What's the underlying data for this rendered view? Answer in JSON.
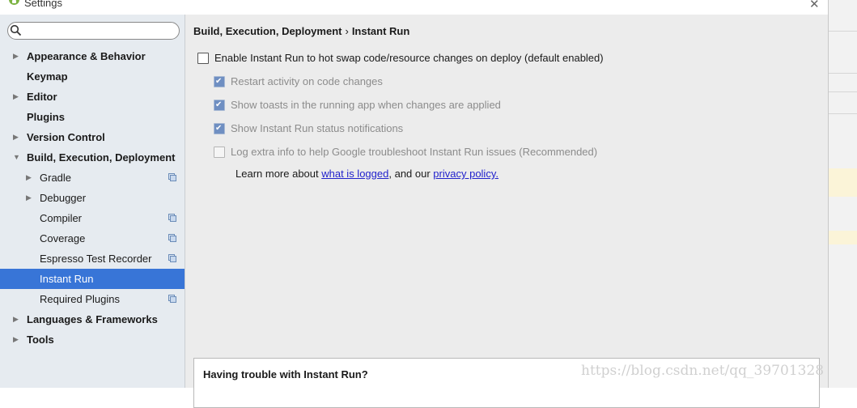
{
  "window": {
    "title": "Settings"
  },
  "search": {
    "placeholder": ""
  },
  "sidebar": {
    "items": [
      {
        "label": "Appearance & Behavior",
        "level": 0,
        "bold": true,
        "expandable": true,
        "expanded": false,
        "project_icon": false
      },
      {
        "label": "Keymap",
        "level": 0,
        "bold": true,
        "expandable": false,
        "project_icon": false
      },
      {
        "label": "Editor",
        "level": 0,
        "bold": true,
        "expandable": true,
        "expanded": false,
        "project_icon": false
      },
      {
        "label": "Plugins",
        "level": 0,
        "bold": true,
        "expandable": false,
        "project_icon": false
      },
      {
        "label": "Version Control",
        "level": 0,
        "bold": true,
        "expandable": true,
        "expanded": false,
        "project_icon": false
      },
      {
        "label": "Build, Execution, Deployment",
        "level": 0,
        "bold": true,
        "expandable": true,
        "expanded": true,
        "project_icon": false
      },
      {
        "label": "Gradle",
        "level": 1,
        "bold": false,
        "expandable": true,
        "expanded": false,
        "project_icon": true
      },
      {
        "label": "Debugger",
        "level": 1,
        "bold": false,
        "expandable": true,
        "expanded": false,
        "project_icon": false
      },
      {
        "label": "Compiler",
        "level": 1,
        "bold": false,
        "expandable": false,
        "project_icon": true
      },
      {
        "label": "Coverage",
        "level": 1,
        "bold": false,
        "expandable": false,
        "project_icon": true
      },
      {
        "label": "Espresso Test Recorder",
        "level": 1,
        "bold": false,
        "expandable": false,
        "project_icon": true
      },
      {
        "label": "Instant Run",
        "level": 1,
        "bold": false,
        "expandable": false,
        "project_icon": false,
        "selected": true
      },
      {
        "label": "Required Plugins",
        "level": 1,
        "bold": false,
        "expandable": false,
        "project_icon": true
      },
      {
        "label": "Languages & Frameworks",
        "level": 0,
        "bold": true,
        "expandable": true,
        "expanded": false,
        "project_icon": false
      },
      {
        "label": "Tools",
        "level": 0,
        "bold": true,
        "expandable": true,
        "expanded": false,
        "project_icon": false
      }
    ]
  },
  "breadcrumb": {
    "parent": "Build, Execution, Deployment",
    "separator": "›",
    "current": "Instant Run"
  },
  "options": [
    {
      "label": "Enable Instant Run to hot swap code/resource changes on deploy (default enabled)",
      "checked": false,
      "enabled": true
    },
    {
      "label": "Restart activity on code changes",
      "checked": true,
      "enabled": false
    },
    {
      "label": "Show toasts in the running app when changes are applied",
      "checked": true,
      "enabled": false
    },
    {
      "label": "Show Instant Run status notifications",
      "checked": true,
      "enabled": false
    },
    {
      "label": "Log extra info to help Google troubleshoot Instant Run issues (Recommended)",
      "checked": false,
      "enabled": false
    }
  ],
  "learn_more": {
    "prefix": "Learn more about ",
    "link1": "what is logged",
    "middle": ", and our ",
    "link2": "privacy policy."
  },
  "trouble_panel": {
    "title": "Having trouble with Instant Run?"
  },
  "watermark": "https://blog.csdn.net/qq_39701328",
  "colors": {
    "selection": "#3875d7",
    "sidebar_bg": "#e6ebf0",
    "content_bg": "#ececec",
    "link": "#2222cc"
  }
}
